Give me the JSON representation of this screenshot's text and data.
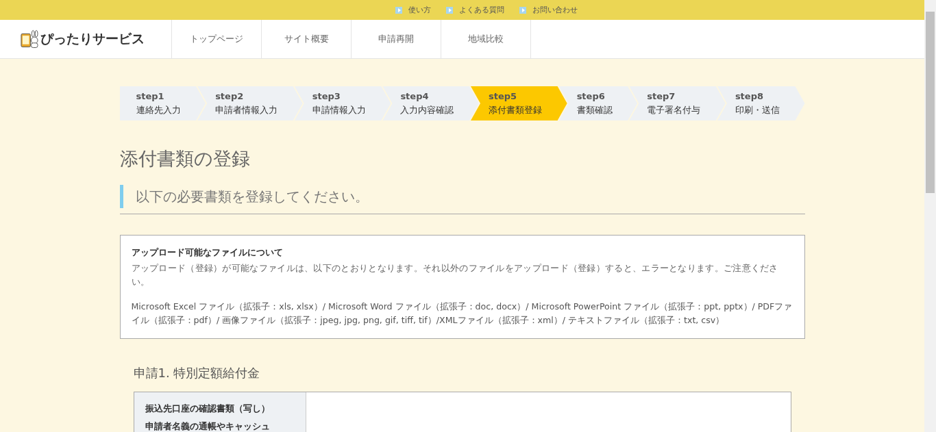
{
  "top_links": [
    "使い方",
    "よくある質問",
    "お問い合わせ"
  ],
  "logo": {
    "text": "ぴったりサービス"
  },
  "nav": [
    "トップページ",
    "サイト概要",
    "申請再開",
    "地域比較"
  ],
  "steps": [
    {
      "number": "step1",
      "label": "連絡先入力",
      "selected": false
    },
    {
      "number": "step2",
      "label": "申請者情報入力",
      "selected": false
    },
    {
      "number": "step3",
      "label": "申請情報入力",
      "selected": false
    },
    {
      "number": "step4",
      "label": "入力内容確認",
      "selected": false
    },
    {
      "number": "step5",
      "label": "添付書類登録",
      "selected": true
    },
    {
      "number": "step6",
      "label": "書類確認",
      "selected": false
    },
    {
      "number": "step7",
      "label": "電子署名付与",
      "selected": false
    },
    {
      "number": "step8",
      "label": "印刷・送信",
      "selected": false
    }
  ],
  "title": "添付書類の登録",
  "subtitle": "以下の必要書類を登録してください。",
  "notice": {
    "heading": "アップロード可能なファイルについて",
    "body": "アップロード（登録）が可能なファイルは、以下のとおりとなります。それ以外のファイルをアップロード（登録）すると、エラーとなります。ご注意ください。",
    "file_types": "Microsoft Excel ファイル（拡張子：xls, xlsx）/ Microsoft Word ファイル（拡張子：doc, docx）/ Microsoft PowerPoint ファイル（拡張子：ppt, pptx）/ PDFファイル（拡張子：pdf）/ 画像ファイル（拡張子：jpeg, jpg, png, gif, tiff, tif）/XMLファイル（拡張子：xml）/ テキストファイル（拡張子：txt, csv）"
  },
  "section": {
    "heading": "申請1. 特別定額給付金",
    "rows": [
      {
        "label_lines": [
          "振込先口座の確認書類（写し）",
          "申請者名義の通帳やキャッシュ"
        ]
      }
    ]
  }
}
